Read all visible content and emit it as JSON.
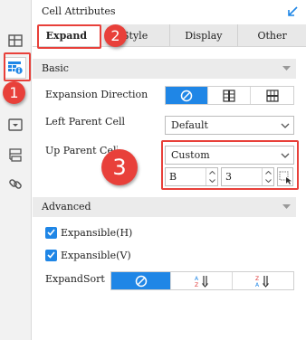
{
  "panel": {
    "title": "Cell Attributes"
  },
  "tabs": [
    {
      "label": "Expand",
      "active": true
    },
    {
      "label": "Style",
      "active": false
    },
    {
      "label": "Display",
      "active": false
    },
    {
      "label": "Other",
      "active": false
    }
  ],
  "basic": {
    "title": "Basic",
    "expansion_direction": {
      "label": "Expansion Direction",
      "options": [
        "none-icon",
        "vertical-expand-icon",
        "horizontal-expand-icon"
      ],
      "selected": 0
    },
    "left_parent": {
      "label": "Left Parent Cell",
      "value": "Default"
    },
    "up_parent": {
      "label": "Up Parent Cell",
      "value": "Custom",
      "column": "B",
      "row": "3"
    }
  },
  "advanced": {
    "title": "Advanced",
    "expansible_h": {
      "label": "Expansible(H)",
      "checked": true
    },
    "expansible_v": {
      "label": "Expansible(V)",
      "checked": true
    },
    "expand_sort": {
      "label": "ExpandSort",
      "options": [
        "none-icon",
        "sort-ascending-icon",
        "sort-descending-icon"
      ],
      "selected": 0
    }
  },
  "annotations": {
    "step1": "1",
    "step2": "2",
    "step3": "3"
  },
  "colors": {
    "accent": "#1f86e6",
    "annotation": "#e8403a"
  }
}
